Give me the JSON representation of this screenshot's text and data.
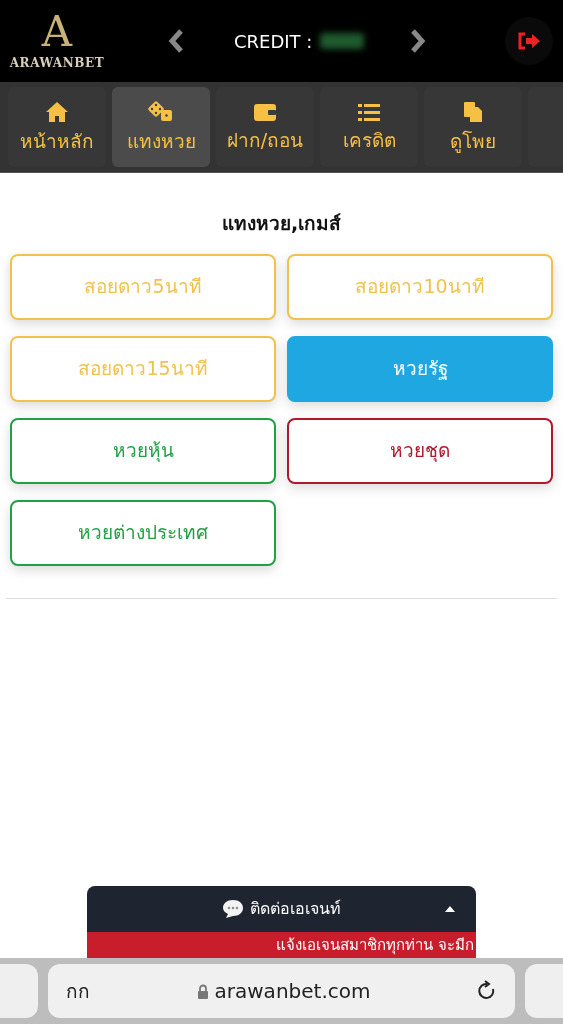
{
  "header": {
    "logo_letter": "A",
    "brand": "ARAWANBET",
    "credit_label": "CREDIT :"
  },
  "nav": [
    {
      "label": "หน้าหลัก",
      "selected": false
    },
    {
      "label": "แทงหวย",
      "selected": true
    },
    {
      "label": "ฝาก/ถอน",
      "selected": false
    },
    {
      "label": "เครดิต",
      "selected": false
    },
    {
      "label": "ดูโพย",
      "selected": false
    }
  ],
  "title": "แทงหวย,เกมส์",
  "games": [
    {
      "label": "สอยดาว5นาที",
      "kind": "outline",
      "color": "#f0c24b"
    },
    {
      "label": "สอยดาว10นาที",
      "kind": "outline",
      "color": "#f0c24b"
    },
    {
      "label": "สอยดาว15นาที",
      "kind": "outline",
      "color": "#f0c24b"
    },
    {
      "label": "หวยรัฐ",
      "kind": "filled",
      "color": "#1ea7e1"
    },
    {
      "label": "หวยหุ้น",
      "kind": "outline",
      "color": "#22a045"
    },
    {
      "label": "หวยชุด",
      "kind": "outline",
      "color": "#b0182c"
    },
    {
      "label": "หวยต่างประเทศ",
      "kind": "outline",
      "color": "#22a045"
    }
  ],
  "chat": {
    "label": "ติดต่อเอเจนท์",
    "expanded": false,
    "notice": "แจ้งเอเจนสมาชิกทุกท่าน จะมีก"
  },
  "browser": {
    "text_size": "กก",
    "url": "arawanbet.com"
  }
}
